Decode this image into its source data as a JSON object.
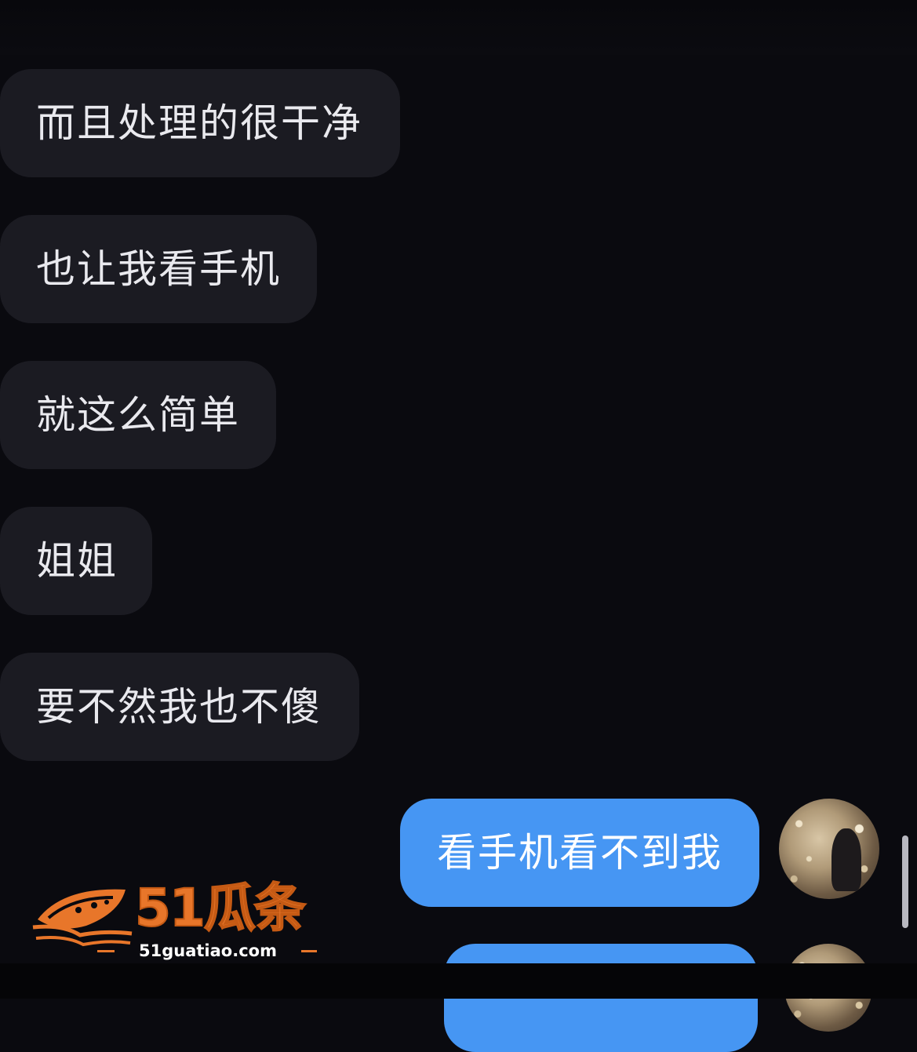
{
  "messages": {
    "incoming": [
      "而且处理的很干净",
      "也让我看手机",
      "就这么简单",
      "姐姐",
      "要不然我也不傻"
    ],
    "outgoing": [
      "看手机看不到我",
      ""
    ]
  },
  "watermark": {
    "brand": "51瓜条",
    "url": "51guatiao.com"
  },
  "colors": {
    "background": "#0a0a0f",
    "incoming_bubble": "#1b1b22",
    "outgoing_bubble": "#4696f3",
    "watermark": "#e8762a"
  }
}
